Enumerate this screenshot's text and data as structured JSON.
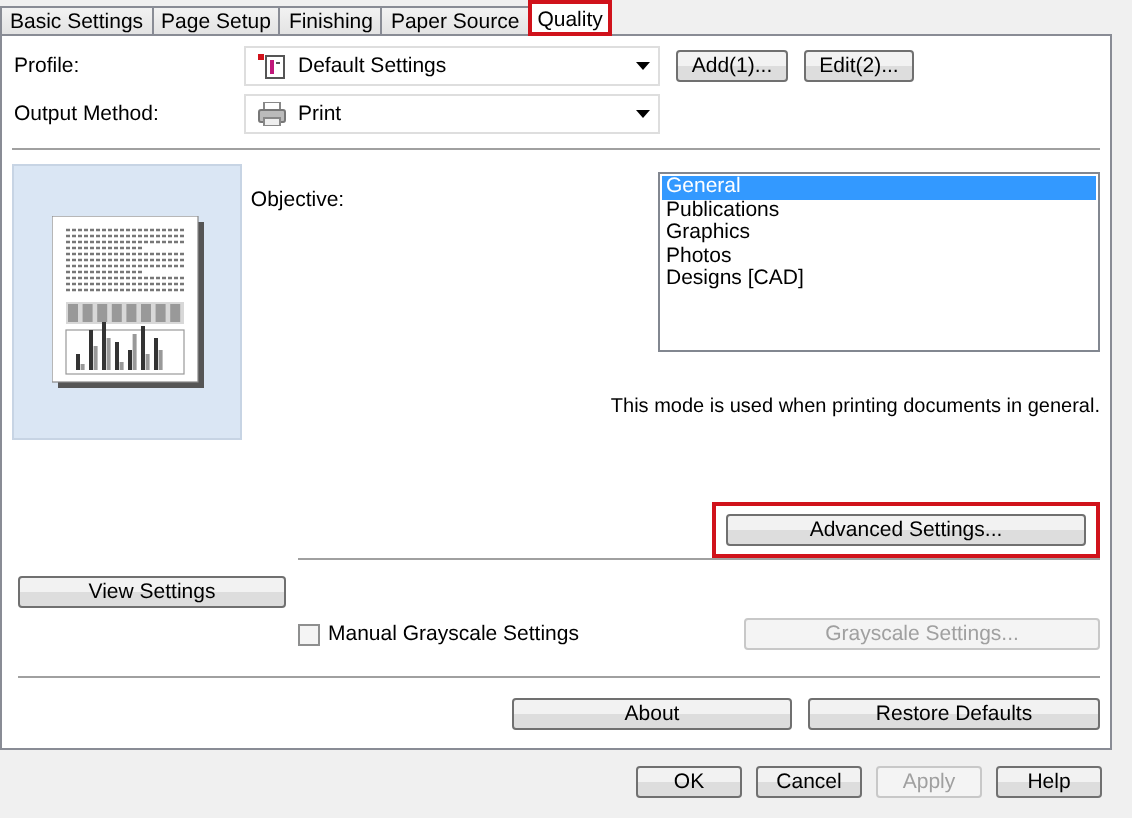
{
  "tabs": [
    {
      "label": "Basic Settings",
      "selected": false,
      "highlighted": false
    },
    {
      "label": "Page Setup",
      "selected": false,
      "highlighted": false
    },
    {
      "label": "Finishing",
      "selected": false,
      "highlighted": false
    },
    {
      "label": "Paper Source",
      "selected": false,
      "highlighted": false
    },
    {
      "label": "Quality",
      "selected": true,
      "highlighted": true
    }
  ],
  "profile": {
    "label": "Profile:",
    "value": "Default Settings",
    "modified": true,
    "buttons": [
      "Add(1)...",
      "Edit(2)..."
    ]
  },
  "output_method": {
    "label": "Output Method:",
    "value": "Print"
  },
  "objective": {
    "label": "Objective:",
    "items": [
      {
        "label": "General",
        "selected": true
      },
      {
        "label": "Publications",
        "selected": false
      },
      {
        "label": "Graphics",
        "selected": false
      },
      {
        "label": "Photos",
        "selected": false
      },
      {
        "label": "Designs [CAD]",
        "selected": false
      }
    ],
    "description": "This mode is used when printing documents in general."
  },
  "advanced_button": {
    "label": "Advanced Settings...",
    "highlighted": true
  },
  "view_settings_button": "View Settings",
  "manual_grayscale": {
    "label": "Manual Grayscale Settings",
    "checked": false
  },
  "grayscale_button": {
    "label": "Grayscale Settings...",
    "disabled": true
  },
  "panel_buttons": [
    "About",
    "Restore Defaults"
  ],
  "dialog_buttons": [
    {
      "label": "OK",
      "disabled": false
    },
    {
      "label": "Cancel",
      "disabled": false
    },
    {
      "label": "Apply",
      "disabled": true
    },
    {
      "label": "Help",
      "disabled": false
    }
  ]
}
